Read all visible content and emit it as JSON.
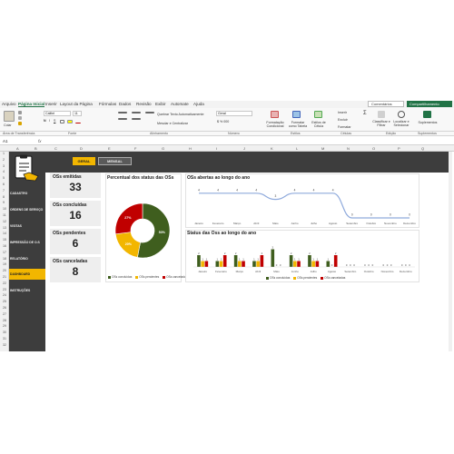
{
  "ribbon_tabs": [
    "Arquivo",
    "Página Inicial",
    "Inserir",
    "Layout da Página",
    "Fórmulas",
    "Dados",
    "Revisão",
    "Exibir",
    "Automate",
    "Ajuda"
  ],
  "ribbon_buttons": {
    "comments": "Comentários",
    "share": "Compartilhamento"
  },
  "ribbon": {
    "paste_label": "Colar",
    "font_name": "Calibri",
    "font_size": "11",
    "wrap_text": "Quebrar Texto Automaticamente",
    "merge_center": "Mesclar e Centralizar",
    "number_format": "Geral",
    "cond_format": "Formatação Condicional",
    "format_table": "Formatar como Tabela",
    "cell_styles": "Estilos de Célula",
    "insert": "Inserir",
    "delete": "Excluir",
    "format": "Formatar",
    "sort_filter": "Classificar e Filtrar",
    "find_select": "Localizar e Selecionar",
    "addins": "Suplementos"
  },
  "ribbon_groups": [
    "Área de Transferência",
    "Fonte",
    "Alinhamento",
    "Número",
    "Estilos",
    "Células",
    "Edição",
    "Suplementos"
  ],
  "formula_bar": {
    "name_box": "A1",
    "fx": "fx",
    "value": ""
  },
  "columns": [
    "A",
    "B",
    "C",
    "D",
    "E",
    "F",
    "G",
    "H",
    "I",
    "J",
    "K",
    "L",
    "M",
    "N",
    "O",
    "P",
    "Q",
    "R",
    "S",
    "T"
  ],
  "rows": [
    "1",
    "2",
    "3",
    "4",
    "5",
    "6",
    "7",
    "8",
    "9",
    "10",
    "11",
    "12",
    "13",
    "14",
    "15",
    "16",
    "17",
    "18",
    "19",
    "20",
    "21",
    "22",
    "23",
    "24",
    "25",
    "26",
    "27",
    "28",
    "29",
    "30",
    "31",
    "32"
  ],
  "top_buttons": {
    "geral": "GERAL",
    "mensal": "MENSAL"
  },
  "sidebar": [
    {
      "label": "CADASTRO",
      "active": false
    },
    {
      "label": "ORDENS DE SERVIÇO",
      "active": false
    },
    {
      "label": "VISITAS",
      "active": false
    },
    {
      "label": "IMPRESSÃO DE O.S",
      "active": false
    },
    {
      "label": "RELATÓRIO",
      "active": false
    },
    {
      "label": "DASHBOARD",
      "active": true
    },
    {
      "label": "INSTRUÇÕES",
      "active": false
    }
  ],
  "kpis": [
    {
      "title": "OSs emitidas",
      "value": "33"
    },
    {
      "title": "OSs concluídas",
      "value": "16"
    },
    {
      "title": "OSs pendentes",
      "value": "6"
    },
    {
      "title": "OSs canceladas",
      "value": "8"
    }
  ],
  "colors": {
    "concluidas": "#3f5e1e",
    "pendentes": "#f2b600",
    "canceladas": "#c00000",
    "line": "#8faadc",
    "accent": "#f2b600",
    "dark": "#3d3d3d"
  },
  "chart_data": [
    {
      "type": "pie",
      "title": "Percentual dos status das OSs",
      "categories": [
        "OSs concluídas",
        "OSs pendentes",
        "OSs canceladas"
      ],
      "values": [
        53,
        20,
        27
      ],
      "labels": [
        "53%",
        "20%",
        "27%"
      ],
      "donut": true,
      "legend": "bottom"
    },
    {
      "type": "line",
      "title": "OSs abertas ao longo do ano",
      "categories": [
        "Janeiro",
        "Fevereiro",
        "Março",
        "Abril",
        "Maio",
        "Junho",
        "Julho",
        "Agosto",
        "Setembro",
        "Outubro",
        "Novembro",
        "Dezembro"
      ],
      "values": [
        4,
        4,
        4,
        4,
        3,
        4,
        4,
        4,
        0,
        0,
        0,
        0
      ],
      "ylim": [
        0,
        5
      ]
    },
    {
      "type": "bar",
      "title": "Status das Oss ao longo do ano",
      "categories": [
        "Janeiro",
        "Fevereiro",
        "Março",
        "Abril",
        "Maio",
        "Junho",
        "Julho",
        "Agosto",
        "Setembro",
        "Outubro",
        "Novembro",
        "Dezembro"
      ],
      "series": [
        {
          "name": "OSs concluídas",
          "values": [
            2,
            1,
            2,
            1,
            3,
            2,
            2,
            1,
            0,
            0,
            0,
            0
          ]
        },
        {
          "name": "OSs pendentes",
          "values": [
            1,
            1,
            1,
            1,
            0,
            1,
            1,
            0,
            0,
            0,
            0,
            0
          ]
        },
        {
          "name": "OSs canceladas",
          "values": [
            1,
            2,
            1,
            2,
            0,
            1,
            1,
            2,
            0,
            0,
            0,
            0
          ]
        }
      ],
      "ylim": [
        0,
        4
      ],
      "legend": "bottom"
    }
  ]
}
